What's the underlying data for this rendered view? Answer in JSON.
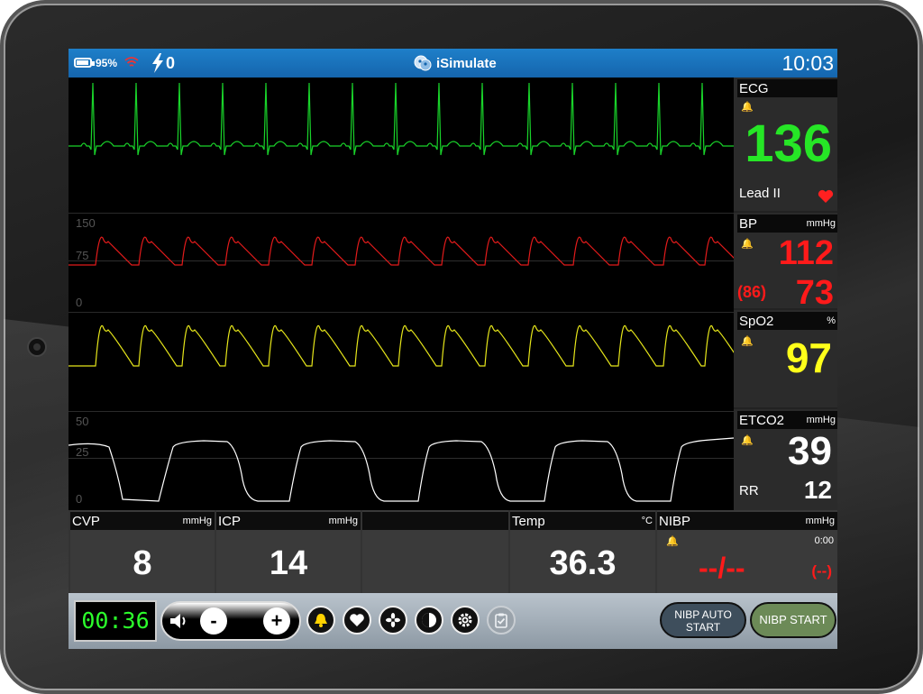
{
  "status": {
    "battery_pct": "95%",
    "battery_level": 0.95,
    "shock_count": "0",
    "app_title": "iSimulate",
    "clock": "10:03"
  },
  "waves": {
    "bp_axis": [
      "150",
      "75",
      "0"
    ],
    "etco2_axis": [
      "50",
      "25",
      "0"
    ],
    "colors": {
      "ecg": "#19d42a",
      "bp": "#e41b1b",
      "spo2": "#e6e61a",
      "etco2": "#ffffff"
    }
  },
  "vitals": {
    "ecg": {
      "name": "ECG",
      "value": "136",
      "lead": "Lead II",
      "color": "#26e626"
    },
    "bp": {
      "name": "BP",
      "unit": "mmHg",
      "systolic": "112",
      "diastolic": "73",
      "mean": "(86)",
      "color": "#ff1a1a"
    },
    "spo2": {
      "name": "SpO2",
      "unit": "%",
      "value": "97",
      "color": "#ffff1a"
    },
    "etco2": {
      "name": "ETCO2",
      "unit": "mmHg",
      "value": "39",
      "rr_label": "RR",
      "rr_value": "12"
    }
  },
  "bottom": {
    "cvp": {
      "name": "CVP",
      "unit": "mmHg",
      "value": "8"
    },
    "icp": {
      "name": "ICP",
      "unit": "mmHg",
      "value": "14"
    },
    "temp": {
      "name": "Temp",
      "unit": "°C",
      "value": "36.3"
    },
    "nibp": {
      "name": "NIBP",
      "unit": "mmHg",
      "time": "0:00",
      "value": "--/--",
      "mean": "(--)"
    }
  },
  "toolbar": {
    "timer": "00:36",
    "minus": "-",
    "plus": "+",
    "nibp_auto": "NIBP AUTO START",
    "nibp_start": "NIBP START"
  }
}
